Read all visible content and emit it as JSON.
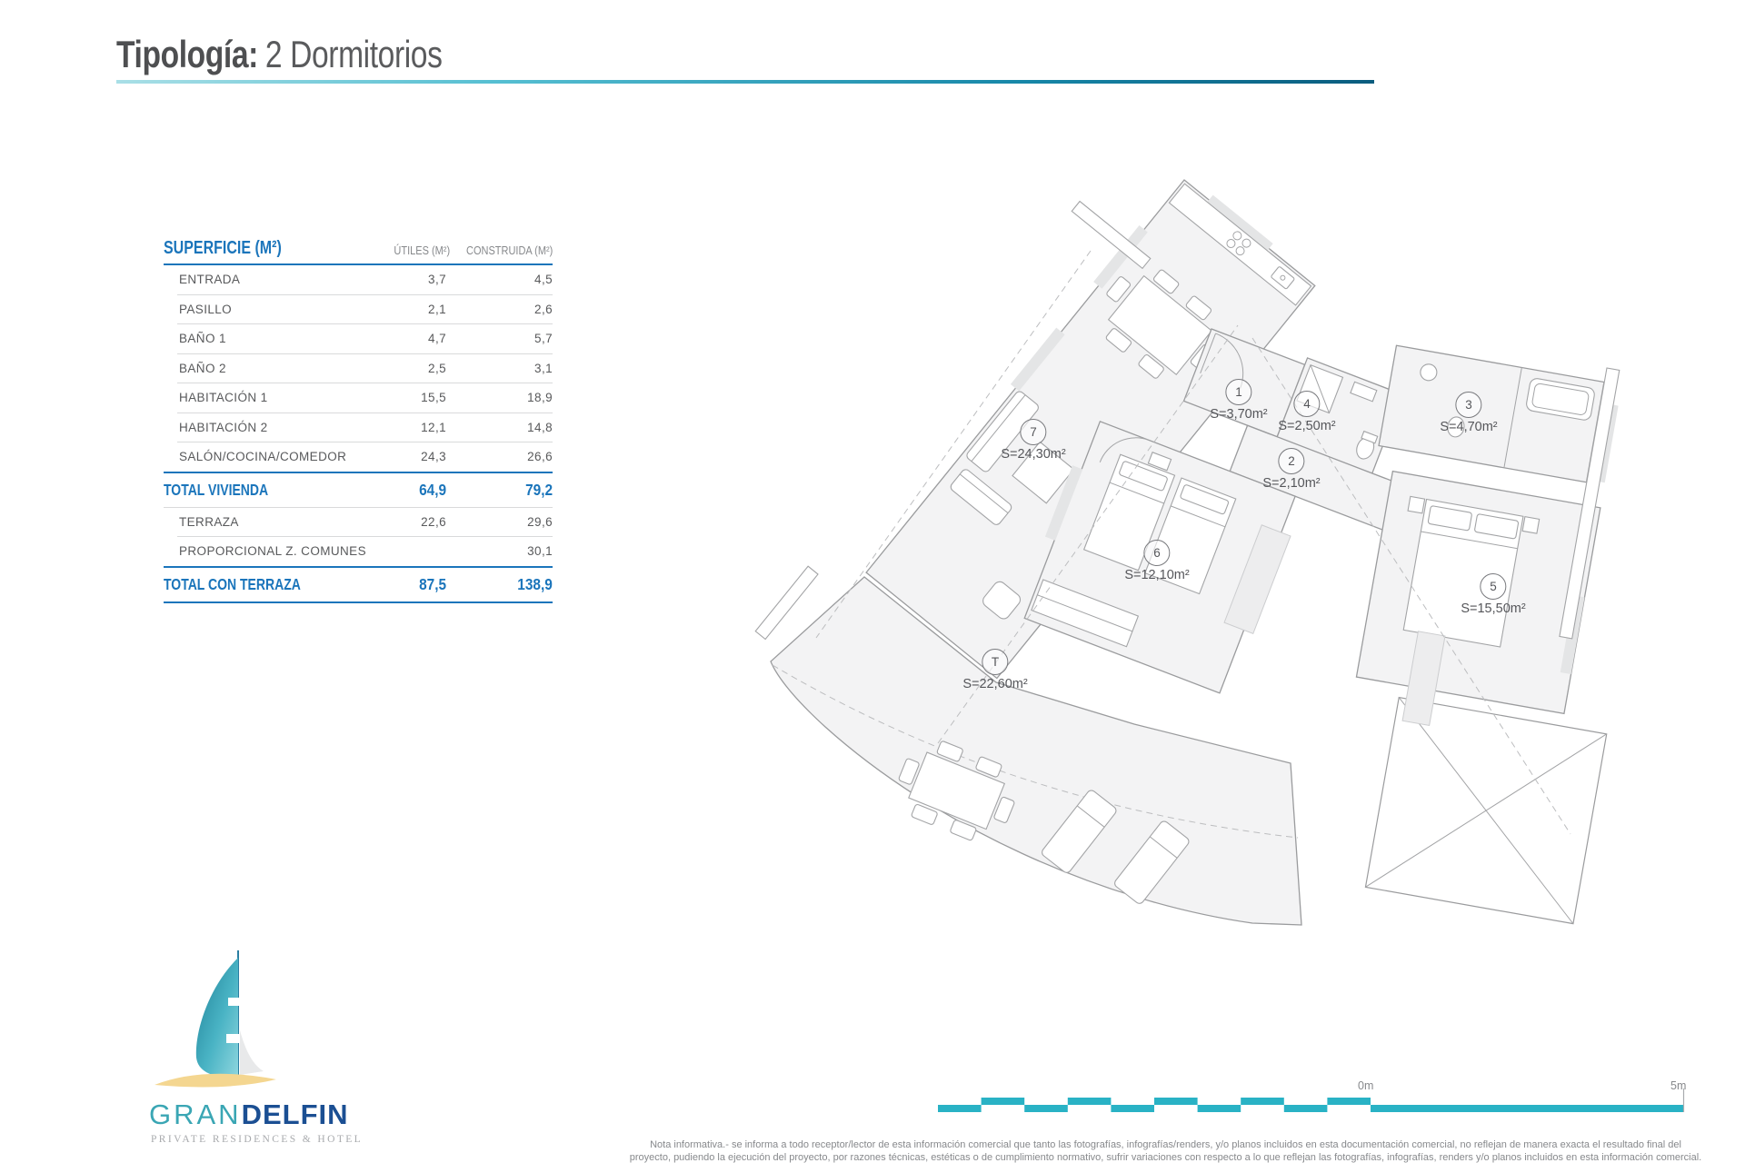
{
  "title": {
    "prefix": "Tipología:",
    "value": "2 Dormitorios"
  },
  "table": {
    "header": {
      "col1": "SUPERFICIE (M²)",
      "col2": "ÚTILES (M²)",
      "col3": "CONSTRUIDA (M²)"
    },
    "rows": [
      {
        "label": "ENTRADA",
        "utiles": "3,7",
        "construida": "4,5"
      },
      {
        "label": "PASILLO",
        "utiles": "2,1",
        "construida": "2,6"
      },
      {
        "label": "BAÑO 1",
        "utiles": "4,7",
        "construida": "5,7"
      },
      {
        "label": "BAÑO 2",
        "utiles": "2,5",
        "construida": "3,1"
      },
      {
        "label": "HABITACIÓN 1",
        "utiles": "15,5",
        "construida": "18,9"
      },
      {
        "label": "HABITACIÓN 2",
        "utiles": "12,1",
        "construida": "14,8"
      },
      {
        "label": "SALÓN/COCINA/COMEDOR",
        "utiles": "24,3",
        "construida": "26,6"
      }
    ],
    "total_vivienda": {
      "label": "TOTAL VIVIENDA",
      "utiles": "64,9",
      "construida": "79,2"
    },
    "extra_rows": [
      {
        "label": "TERRAZA",
        "utiles": "22,6",
        "construida": "29,6"
      },
      {
        "label": "PROPORCIONAL Z. COMUNES",
        "utiles": "",
        "construida": "30,1"
      }
    ],
    "total_terraza": {
      "label": "TOTAL CON TERRAZA",
      "utiles": "87,5",
      "construida": "138,9"
    }
  },
  "plan": {
    "rooms": [
      {
        "number": "1",
        "area": "S=3,70m²"
      },
      {
        "number": "2",
        "area": "S=2,10m²"
      },
      {
        "number": "3",
        "area": "S=4,70m²"
      },
      {
        "number": "4",
        "area": "S=2,50m²"
      },
      {
        "number": "5",
        "area": "S=15,50m²"
      },
      {
        "number": "6",
        "area": "S=12,10m²"
      },
      {
        "number": "7",
        "area": "S=24,30m²"
      },
      {
        "number": "T",
        "area": "S=22,60m²"
      }
    ]
  },
  "logo": {
    "name_part1": "GRAN",
    "name_part2": "DELFIN",
    "tagline": "PRIVATE RESIDENCES & HOTEL"
  },
  "scalebar": {
    "start_label": "0m",
    "end_label": "5m"
  },
  "note": {
    "line1": "Nota informativa.- se informa a todo receptor/lector de esta información comercial que tanto las fotografías, infografías/renders, y/o planos incluidos en esta documentación comercial, no reflejan de manera exacta el resultado final del",
    "line2": "proyecto, pudiendo la ejecución del proyecto, por razones técnicas, estéticas o de cumplimiento normativo, sufrir variaciones con respecto a lo que reflejan las fotografías, infografías, renders y/o planos incluidos en esta información comercial."
  },
  "colors": {
    "accent_blue": "#1b75bb",
    "teal_scalebar": "#29b2c5",
    "logo_teal": "#3aa6b4",
    "logo_navy": "#1b4f93",
    "text_gray": "#58595b",
    "rule_gradient_start": "#a9dfe6",
    "rule_gradient_end": "#0a5c7e"
  }
}
